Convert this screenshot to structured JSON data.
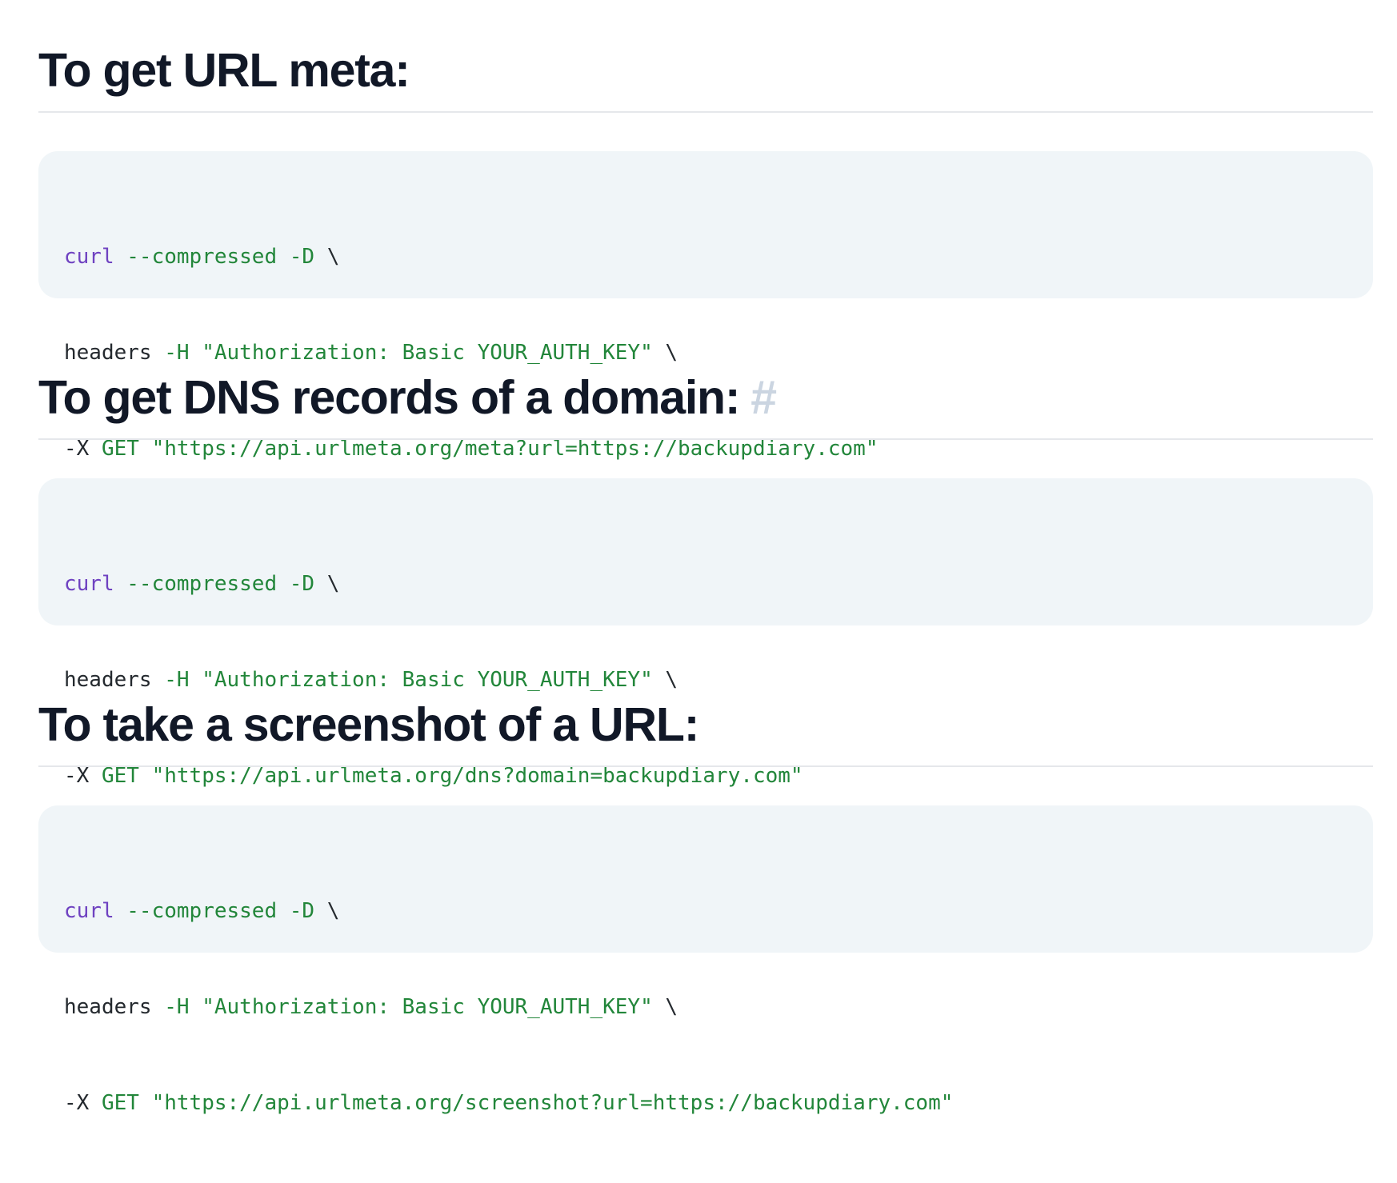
{
  "sections": [
    {
      "title": "To get URL meta:",
      "anchor": "",
      "code": {
        "line1": {
          "cmd": "curl",
          "flags": " --compressed -D",
          "cont": " \\"
        },
        "line2": {
          "plain": "headers ",
          "flag": "-H",
          "str": " \"Authorization: Basic YOUR_AUTH_KEY\"",
          "cont": " \\"
        },
        "line3": {
          "plain": "-X ",
          "str": "GET \"https://api.urlmeta.org/meta?url=https://backupdiary.com\""
        }
      }
    },
    {
      "title": "To get DNS records of a domain:",
      "anchor": "#",
      "code": {
        "line1": {
          "cmd": "curl",
          "flags": " --compressed -D",
          "cont": " \\"
        },
        "line2": {
          "plain": "headers ",
          "flag": "-H",
          "str": " \"Authorization: Basic YOUR_AUTH_KEY\"",
          "cont": " \\"
        },
        "line3": {
          "plain": "-X ",
          "str": "GET \"https://api.urlmeta.org/dns?domain=backupdiary.com\""
        }
      }
    },
    {
      "title": "To take a screenshot of a URL:",
      "anchor": "",
      "code": {
        "line1": {
          "cmd": "curl",
          "flags": " --compressed -D",
          "cont": " \\"
        },
        "line2": {
          "plain": "headers ",
          "flag": "-H",
          "str": " \"Authorization: Basic YOUR_AUTH_KEY\"",
          "cont": " \\"
        },
        "line3": {
          "plain": "-X ",
          "str": "GET \"https://api.urlmeta.org/screenshot?url=https://backupdiary.com\""
        }
      }
    }
  ],
  "colors": {
    "heading": "#111827",
    "code_background": "#f0f5f8",
    "keyword_purple": "#6f42c1",
    "string_green": "#22863a",
    "plain_text": "#24292e",
    "anchor_hash": "#cbd5e1",
    "divider": "#e5e7eb"
  }
}
